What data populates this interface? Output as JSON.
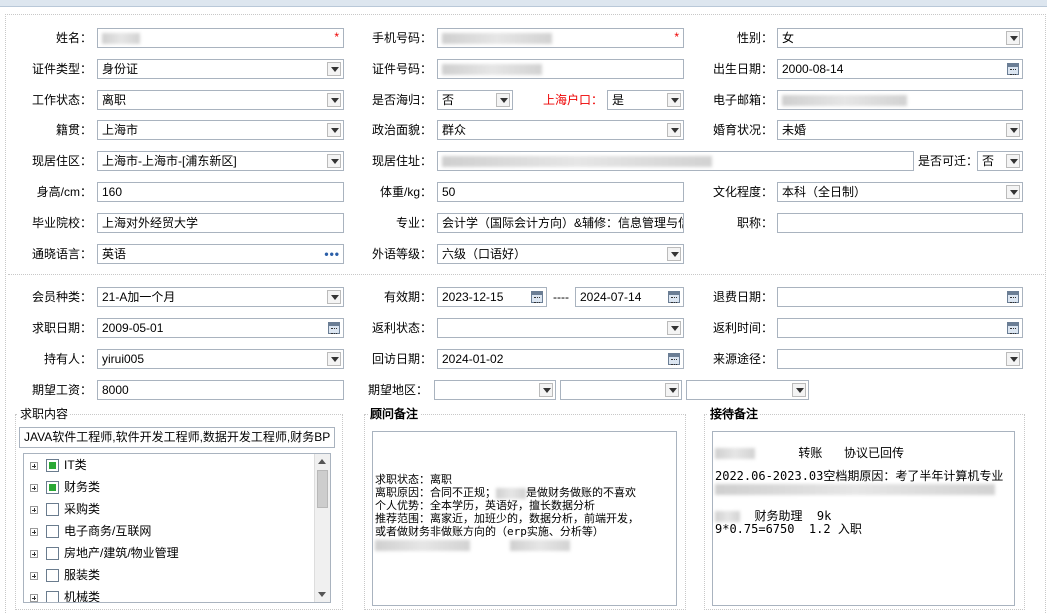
{
  "personal": {
    "name_label": "姓名：",
    "phone_label": "手机号码：",
    "gender_label": "性别：",
    "gender_value": "女",
    "idtype_label": "证件类型：",
    "idtype_value": "身份证",
    "idno_label": "证件号码：",
    "birth_label": "出生日期：",
    "birth_value": "2000-08-14",
    "workstatus_label": "工作状态：",
    "workstatus_value": "离职",
    "returnee_label": "是否海归：",
    "returnee_value": "否",
    "hukou_label": "上海户口：",
    "hukou_value": "是",
    "email_label": "电子邮箱：",
    "native_label": "籍贯：",
    "native_value": "上海市",
    "political_label": "政治面貌：",
    "political_value": "群众",
    "marital_label": "婚育状况：",
    "marital_value": "未婚",
    "residence_area_label": "现居住区：",
    "residence_area_value": "上海市-上海市-[浦东新区]",
    "residence_addr_label": "现居住址：",
    "relocate_label": "是否可迁：",
    "relocate_value": "否",
    "height_label": "身高/cm：",
    "height_value": "160",
    "weight_label": "体重/kg：",
    "weight_value": "50",
    "education_label": "文化程度：",
    "education_value": "本科（全日制）",
    "school_label": "毕业院校：",
    "school_value": "上海对外经贸大学",
    "major_label": "专业：",
    "major_value": "会计学（国际会计方向）&辅修：信息管理与信",
    "title_label": "职称：",
    "language_label": "通晓语言：",
    "language_value": "英语",
    "language_btn": "•••",
    "foreign_level_label": "外语等级：",
    "foreign_level_value": "六级（口语好）"
  },
  "member": {
    "type_label": "会员种类：",
    "type_value": "21-A加一个月",
    "validity_label": "有效期：",
    "validity_from": "2023-12-15",
    "validity_sep": "----",
    "validity_to": "2024-07-14",
    "refund_label": "退费日期：",
    "jobdate_label": "求职日期：",
    "jobdate_value": "2009-05-01",
    "rebate_status_label": "返利状态：",
    "rebate_time_label": "返利时间：",
    "holder_label": "持有人：",
    "holder_value": "yirui005",
    "revisit_label": "回访日期：",
    "revisit_value": "2024-01-02",
    "source_label": "来源途径：",
    "salary_label": "期望工资：",
    "salary_value": "8000",
    "region_label": "期望地区："
  },
  "job_content": {
    "title": "求职内容",
    "summary": "JAVA软件工程师,软件开发工程师,数据开发工程师,财务BP",
    "tree": [
      {
        "label": "IT类",
        "checked": true
      },
      {
        "label": "财务类",
        "checked": true
      },
      {
        "label": "采购类",
        "checked": false
      },
      {
        "label": "电子商务/互联网",
        "checked": false
      },
      {
        "label": "房地产/建筑/物业管理",
        "checked": false
      },
      {
        "label": "服装类",
        "checked": false
      },
      {
        "label": "机械类",
        "checked": false
      }
    ]
  },
  "advisor": {
    "title": "顾问备注",
    "l1": "求职状态：离职",
    "l2a": "离职原因：合同不正规；",
    "l2b": "是做财务做账的不喜欢",
    "l3": "个人优势：全本学历，英语好，擅长数据分析",
    "l4": "推荐范围：离家近，加班少的，数据分析，前端开发，",
    "l5": "或者做财务非做账方向的（erp实施、分析等）"
  },
  "reception": {
    "title": "接待备注",
    "l1": "转账   协议已回传",
    "l2": "2022.06-2023.03空档期原因：考了半年计算机专业",
    "l3": "财务助理  9k",
    "l4": "9*0.75=6750  1.2 入职"
  }
}
